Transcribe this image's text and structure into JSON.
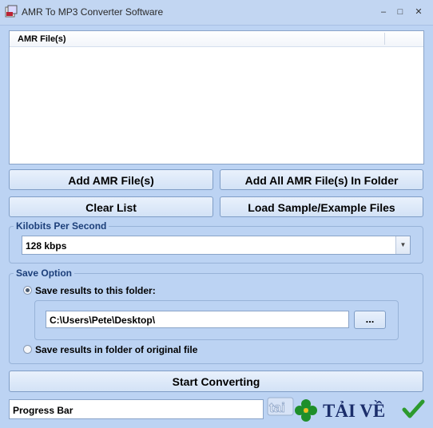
{
  "window": {
    "title": "AMR To MP3 Converter Software",
    "minimize_glyph": "–",
    "maximize_glyph": "□",
    "close_glyph": "✕"
  },
  "file_list": {
    "column_header": "AMR File(s)",
    "rows": []
  },
  "buttons": {
    "add_files": "Add AMR File(s)",
    "add_folder": "Add All AMR File(s) In Folder",
    "clear_list": "Clear List",
    "load_samples": "Load Sample/Example Files",
    "browse": "...",
    "start": "Start Converting"
  },
  "bitrate": {
    "group_title": "Kilobits Per Second",
    "selected": "128 kbps"
  },
  "save_option": {
    "group_title": "Save Option",
    "option_folder": "Save results to this folder:",
    "option_original": "Save results in folder of original file",
    "selected": "folder",
    "folder_path": "C:\\Users\\Pete\\Desktop\\"
  },
  "status": {
    "progress_label": "Progress Bar"
  },
  "watermark": {
    "brand_text": "TẢI VỀ",
    "brand_prefix": "tai"
  },
  "colors": {
    "window_bg": "#bcd3f3",
    "group_title": "#1c3f7a",
    "watermark_navy": "#1b2e6b",
    "check_green": "#2d9a2d"
  }
}
